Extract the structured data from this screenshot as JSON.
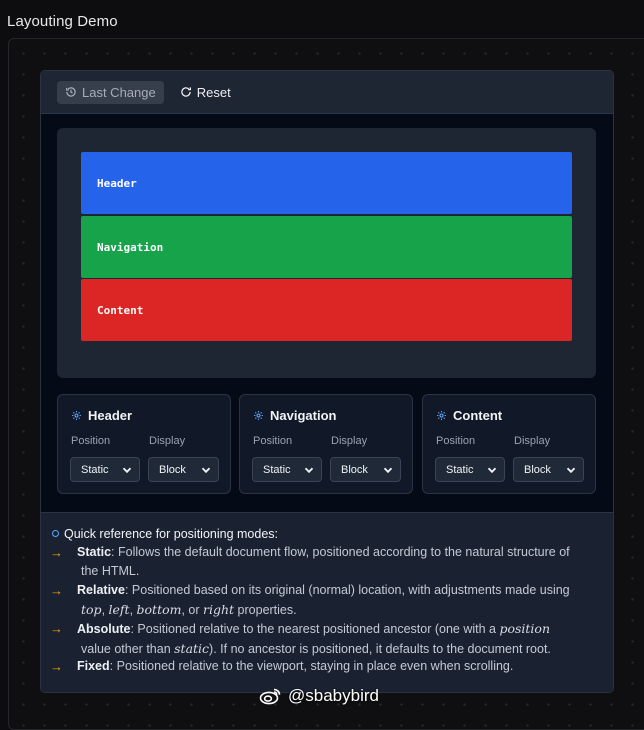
{
  "page": {
    "title": "Layouting Demo"
  },
  "toolbar": {
    "last_change_label": "Last Change",
    "reset_label": "Reset"
  },
  "preview": {
    "header_label": "Header",
    "navigation_label": "Navigation",
    "content_label": "Content"
  },
  "colors": {
    "header": "#2563eb",
    "navigation": "#16a34a",
    "content": "#dc2626",
    "accent": "#f59e0b"
  },
  "controls": [
    {
      "title": "Header",
      "position_label": "Position",
      "display_label": "Display",
      "position_value": "Static",
      "display_value": "Block"
    },
    {
      "title": "Navigation",
      "position_label": "Position",
      "display_label": "Display",
      "position_value": "Static",
      "display_value": "Block"
    },
    {
      "title": "Content",
      "position_label": "Position",
      "display_label": "Display",
      "position_value": "Static",
      "display_value": "Block"
    }
  ],
  "reference": {
    "title": "Quick reference for positioning modes:",
    "items": [
      {
        "term": "Static",
        "line1": ": Follows the default document flow, positioned according to the natural structure of",
        "line2": "the HTML."
      },
      {
        "term": "Relative",
        "pre": ": Positioned based on its original (normal) location, with adjustments made using",
        "code1": "top",
        "sep1": ", ",
        "code2": "left",
        "sep2": ", ",
        "code3": "bottom",
        "sep3": ", or ",
        "code4": "right",
        "post": " properties."
      },
      {
        "term": "Absolute",
        "pre": ": Positioned relative to the nearest positioned ancestor (one with a ",
        "code1": "position",
        "mid": "value other than ",
        "code2": "static",
        "post": "). If no ancestor is positioned, it defaults to the document root."
      },
      {
        "term": "Fixed",
        "line1": ": Positioned relative to the viewport, staying in place even when scrolling."
      }
    ]
  },
  "watermark": {
    "text": "@sbabybird",
    "icon": "weibo-icon"
  }
}
